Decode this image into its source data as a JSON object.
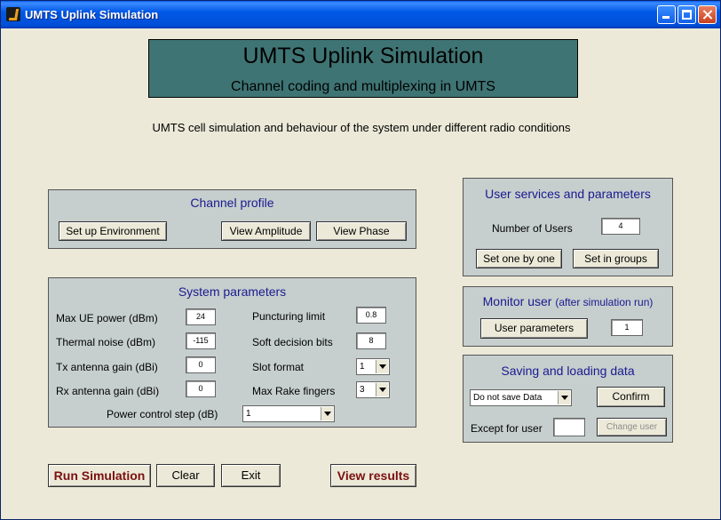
{
  "window": {
    "title": "UMTS Uplink Simulation"
  },
  "header": {
    "title": "UMTS Uplink Simulation",
    "subtitle": "Channel coding and multiplexing in UMTS"
  },
  "description": "UMTS cell simulation and behaviour of the system under different radio conditions",
  "channel_profile": {
    "title": "Channel profile",
    "setup_label": "Set up Environment",
    "amplitude_label": "View Amplitude",
    "phase_label": "View Phase"
  },
  "system_params": {
    "title": "System parameters",
    "max_ue_power_label": "Max UE power (dBm)",
    "max_ue_power_value": "24",
    "thermal_noise_label": "Thermal noise (dBm)",
    "thermal_noise_value": "-115",
    "tx_gain_label": "Tx antenna gain (dBi)",
    "tx_gain_value": "0",
    "rx_gain_label": "Rx antenna gain (dBi)",
    "rx_gain_value": "0",
    "puncturing_label": "Puncturing limit",
    "puncturing_value": "0.8",
    "soft_bits_label": "Soft decision bits",
    "soft_bits_value": "8",
    "slot_format_label": "Slot format",
    "slot_format_value": "1",
    "rake_label": "Max Rake fingers",
    "rake_value": "3",
    "power_step_label": "Power control step (dB)",
    "power_step_value": "1"
  },
  "user_services": {
    "title": "User services and parameters",
    "num_users_label": "Number of  Users",
    "num_users_value": "4",
    "one_by_one_label": "Set one by one",
    "groups_label": "Set in groups"
  },
  "monitor": {
    "title": "Monitor user",
    "title_note": "(after simulation run)",
    "user_params_label": "User parameters",
    "user_value": "1"
  },
  "saving": {
    "title": "Saving and loading data",
    "save_option": "Do not save Data",
    "confirm_label": "Confirm",
    "except_label": "Except for user",
    "except_value": "",
    "change_user_label": "Change user"
  },
  "actions": {
    "run_label": "Run Simulation",
    "clear_label": "Clear",
    "exit_label": "Exit",
    "results_label": "View results"
  }
}
